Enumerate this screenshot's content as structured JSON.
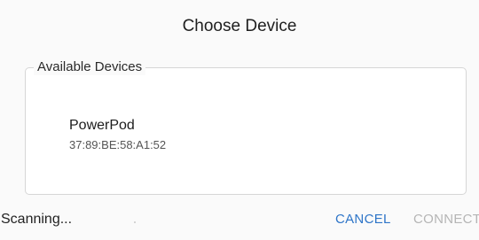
{
  "dialog": {
    "title": "Choose Device",
    "group_label": "Available Devices",
    "devices": [
      {
        "name": "PowerPod",
        "address": "37:89:BE:58:A1:52"
      }
    ],
    "status": "Scanning...",
    "buttons": {
      "cancel": "CANCEL",
      "connect": "CONNECT"
    }
  },
  "colors": {
    "accent": "#2e75c8",
    "disabled": "#b5b5b5"
  }
}
